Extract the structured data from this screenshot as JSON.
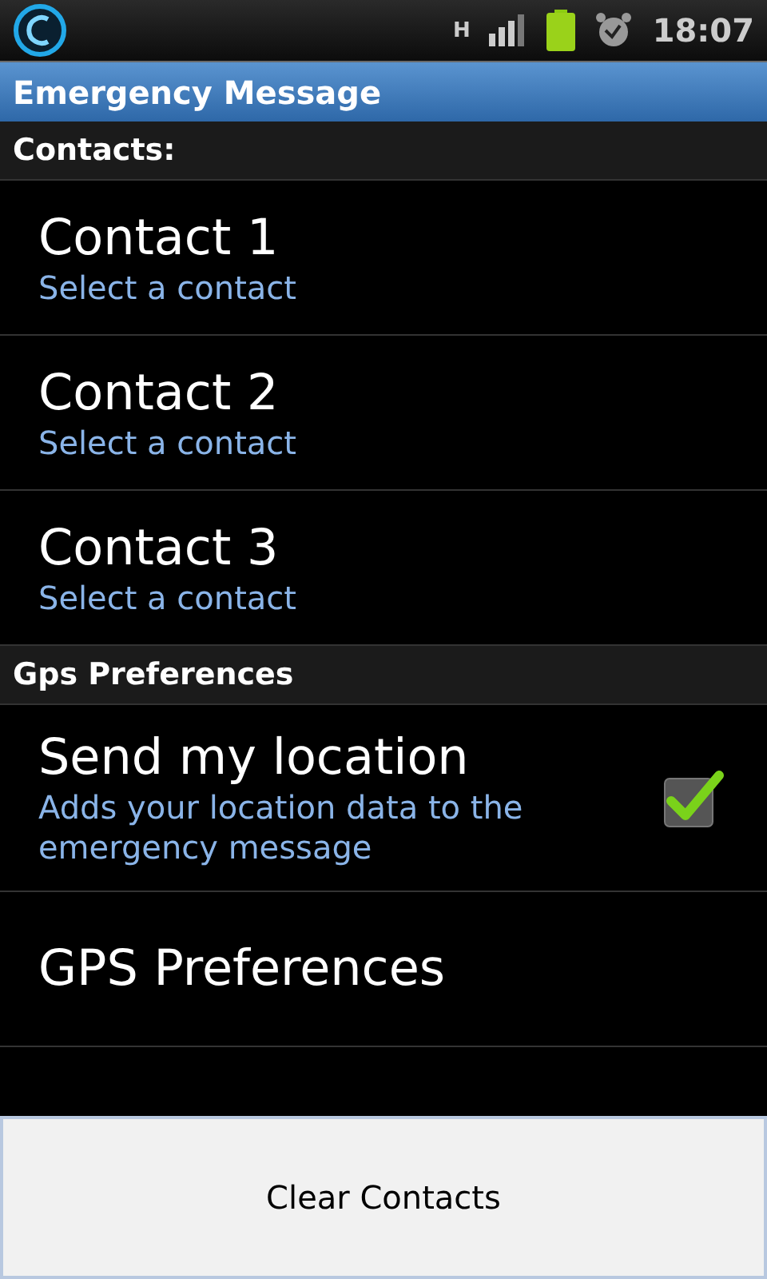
{
  "status_bar": {
    "network": "H",
    "time": "18:07"
  },
  "title": "Emergency Message",
  "sections": [
    {
      "header": "Contacts:",
      "items": [
        {
          "kind": "pref",
          "title": "Contact 1",
          "summary": "Select a contact"
        },
        {
          "kind": "pref",
          "title": "Contact 2",
          "summary": "Select a contact"
        },
        {
          "kind": "pref",
          "title": "Contact 3",
          "summary": "Select a contact"
        }
      ]
    },
    {
      "header": "Gps Preferences",
      "items": [
        {
          "kind": "checkbox",
          "title": "Send my location",
          "summary": "Adds your location data to the emergency message",
          "checked": true
        },
        {
          "kind": "plain",
          "title": "GPS Preferences"
        }
      ]
    }
  ],
  "button": "Clear Contacts"
}
